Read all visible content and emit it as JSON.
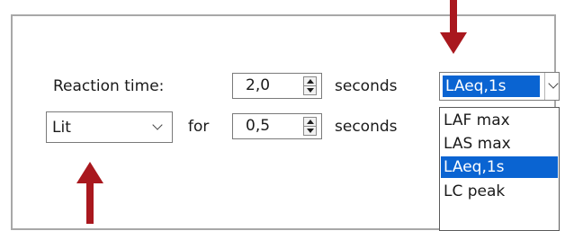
{
  "colors": {
    "accent_arrow": "#a9181e",
    "selection": "#0a64d2",
    "panel_border": "#a8a8a8"
  },
  "row1": {
    "label": "Reaction time:",
    "value": "2,0",
    "unit": "seconds",
    "dropdown_selected": "LAeq,1s"
  },
  "row2": {
    "mode_selected": "Lit",
    "for_label": "for",
    "value": "0,5",
    "unit": "seconds"
  },
  "dropdown_options": [
    "LAF max",
    "LAS max",
    "LAeq,1s",
    "LC peak"
  ],
  "icons": {
    "spin": "spin-up-down-icon",
    "chevron": "chevron-down-icon",
    "arrow": "red-callout-arrow-icon"
  }
}
